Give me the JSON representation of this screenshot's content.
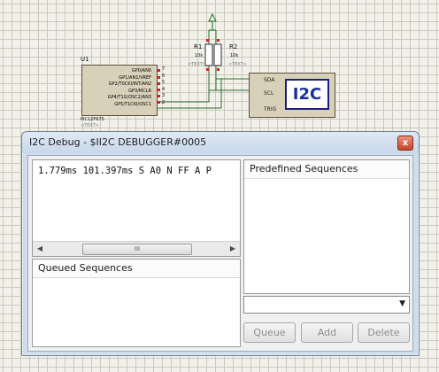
{
  "schematic": {
    "chip_ref": "U1",
    "chip_part": "PIC12F675",
    "chip_text": "<TEXT>",
    "chip_pins": [
      {
        "num": "7",
        "name": "GP0/AN0"
      },
      {
        "num": "6",
        "name": "GP1/AN1/VREF"
      },
      {
        "num": "5",
        "name": "GP2/T0CKI/INT/AN2"
      },
      {
        "num": "4",
        "name": "GP3/MCLR"
      },
      {
        "num": "3",
        "name": "GP4/T1G/OSC2/AN3"
      },
      {
        "num": "2",
        "name": "GP5/T1CKI/OSC1"
      }
    ],
    "r1": {
      "ref": "R1",
      "value": "10k",
      "text": "<TEXT>"
    },
    "r2": {
      "ref": "R2",
      "value": "10k",
      "text": "<TEXT>"
    },
    "i2c": {
      "label": "I2C",
      "pins": [
        "SDA",
        "SCL",
        "TRIG"
      ]
    }
  },
  "window": {
    "title": "I2C Debug - $II2C DEBUGGER#0005",
    "close_glyph": "x",
    "log_line": "1.779ms 101.397ms S A0 N FF A P",
    "scroll": {
      "left": "◀",
      "right": "▶",
      "grip": "III"
    },
    "queued_label": "Queued Sequences",
    "predefined_label": "Predefined Sequences",
    "combo_value": "",
    "combo_arrow": "▼",
    "buttons": {
      "queue": "Queue",
      "add": "Add",
      "delete": "Delete"
    }
  }
}
